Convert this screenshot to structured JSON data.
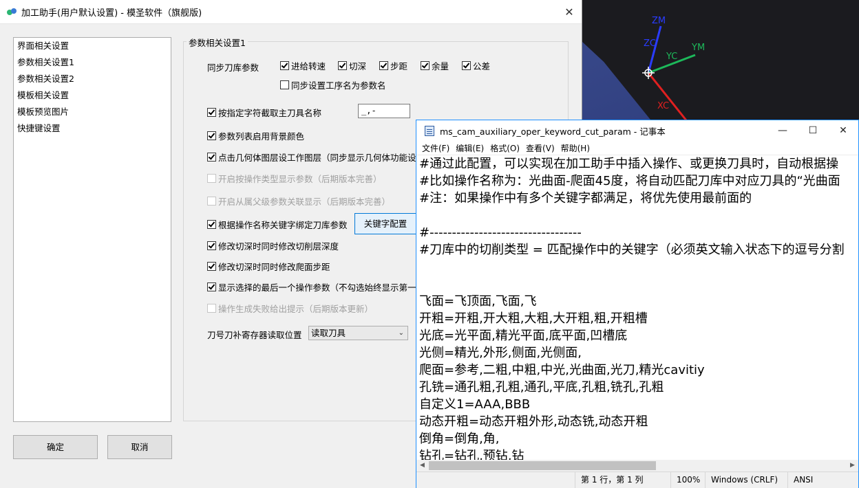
{
  "viewport": {
    "axes": {
      "zm": "ZM",
      "zc": "ZC",
      "yc": "YC",
      "ym": "YM",
      "xc": "XC"
    }
  },
  "dialog": {
    "title": "加工助手(用户默认设置) - 模圣软件（旗舰版)",
    "close_icon": "✕",
    "nav_items": [
      "界面相关设置",
      "参数相关设置1",
      "参数相关设置2",
      "模板相关设置",
      "模板预览图片",
      "快捷键设置"
    ],
    "ok_label": "确定",
    "cancel_label": "取消",
    "group_title": "参数相关设置1",
    "sync_label": "同步刀库参数",
    "sync_options": [
      {
        "label": "进给转速",
        "checked": true
      },
      {
        "label": "切深",
        "checked": true
      },
      {
        "label": "步距",
        "checked": true
      },
      {
        "label": "余量",
        "checked": true
      },
      {
        "label": "公差",
        "checked": true
      }
    ],
    "sync_name_option": {
      "label": "同步设置工序名为参数名",
      "checked": false
    },
    "options": [
      {
        "label": "按指定字符截取主刀具名称",
        "checked": true,
        "disabled": false
      },
      {
        "label": "参数列表启用背景颜色",
        "checked": true,
        "disabled": false
      },
      {
        "label": "点击几何体图层设工作图层（同步显示几何体功能设置",
        "checked": true,
        "disabled": false
      },
      {
        "label": "开启按操作类型显示参数（后期版本完善）",
        "checked": false,
        "disabled": true
      },
      {
        "label": "开启从属父级参数关联显示（后期版本完善）",
        "checked": false,
        "disabled": true
      },
      {
        "label": "根据操作名称关键字绑定刀库参数",
        "checked": true,
        "disabled": false
      },
      {
        "label": "修改切深时同时修改切削层深度",
        "checked": true,
        "disabled": false
      },
      {
        "label": "修改切深时同时修改爬面步距",
        "checked": true,
        "disabled": false
      },
      {
        "label": "显示选择的最后一个操作参数（不勾选始终显示第一个",
        "checked": true,
        "disabled": false
      },
      {
        "label": "操作生成失败给出提示（后期版本更新）",
        "checked": false,
        "disabled": true
      }
    ],
    "separator_value": "_,-",
    "keyword_button": "关键字配置",
    "tool_reg_label": "刀号刀补寄存器读取位置",
    "tool_reg_value": "读取刀具"
  },
  "notepad": {
    "title": "ms_cam_auxiliary_oper_keyword_cut_param - 记事本",
    "menu": [
      "文件(F)",
      "编辑(E)",
      "格式(O)",
      "查看(V)",
      "帮助(H)"
    ],
    "lines": [
      "#通过此配置，可以实现在加工助手中插入操作、或更换刀具时，自动根据操",
      "#比如操作名称为：光曲面-爬面45度，将自动匹配刀库中对应刀具的“光曲面",
      "#注：如果操作中有多个关键字都满足，将优先使用最前面的",
      "",
      "#----------------------------------",
      "#刀库中的切削类型 = 匹配操作中的关键字（必须英文输入状态下的逗号分割",
      "",
      "",
      "飞面=飞顶面,飞面,飞",
      "开粗=开粗,开大粗,大粗,大开粗,粗,开粗槽",
      "光底=光平面,精光平面,底平面,凹槽底",
      "光侧=精光,外形,侧面,光侧面,",
      "爬面=参考,二粗,中粗,中光,光曲面,光刀,精光cavitiy",
      "孔铣=通孔粗,孔粗,通孔,平底,孔粗,铣孔,孔粗",
      "自定义1=AAA,BBB",
      "动态开粗=动态开粗外形,动态铣,动态开粗",
      "倒角=倒角,角,",
      "钻孔=钻孔,预钻,钻"
    ],
    "status": {
      "position": "第 1 行，第 1 列",
      "zoom": "100%",
      "eol": "Windows (CRLF)",
      "encoding": "ANSI"
    }
  }
}
